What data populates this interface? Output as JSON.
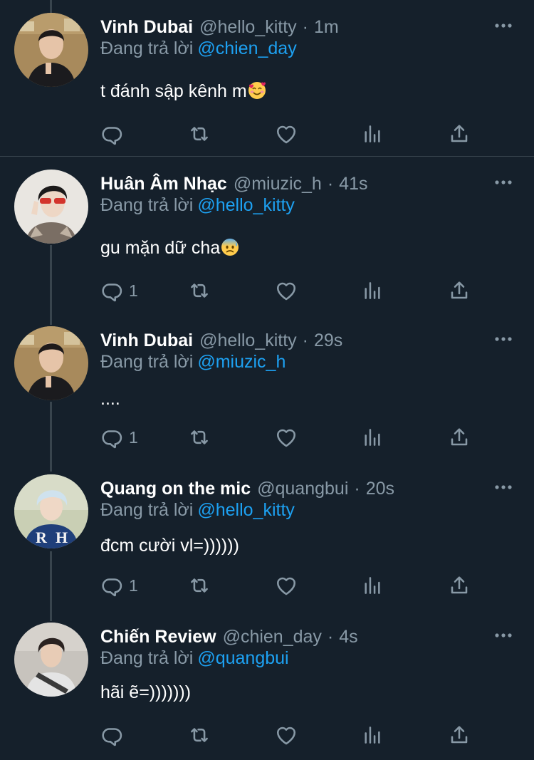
{
  "tweets": [
    {
      "name": "Vinh Dubai",
      "handle": "@hello_kitty",
      "time": "1m",
      "reply_label": "Đang trả lời",
      "reply_to": "@chien_day",
      "text": "t đánh sập kênh m",
      "emoji": "smiling-face-with-hearts",
      "reply_count": ""
    },
    {
      "name": "Huân Âm Nhạc",
      "handle": "@miuzic_h",
      "time": "41s",
      "reply_label": "Đang trả lời",
      "reply_to": "@hello_kitty",
      "text": "gu mặn dữ cha",
      "emoji": "anxious-face-with-sweat",
      "reply_count": "1"
    },
    {
      "name": "Vinh Dubai",
      "handle": "@hello_kitty",
      "time": "29s",
      "reply_label": "Đang trả lời",
      "reply_to": "@miuzic_h",
      "text": "....",
      "emoji": "",
      "reply_count": "1"
    },
    {
      "name": "Quang on the mic",
      "handle": "@quangbui",
      "time": "20s",
      "reply_label": "Đang trả lời",
      "reply_to": "@hello_kitty",
      "text": "đcm cười vl=))))))",
      "emoji": "",
      "reply_count": "1"
    },
    {
      "name": "Chiến Review",
      "handle": "@chien_day",
      "time": "4s",
      "reply_label": "Đang trả lời",
      "reply_to": "@quangbui",
      "text": "hãi ẽ=)))))))",
      "emoji": "",
      "reply_count": ""
    }
  ],
  "dot_separator": "·",
  "icons": [
    "reply-icon",
    "retweet-icon",
    "like-icon",
    "analytics-icon",
    "share-icon",
    "more-options-icon"
  ],
  "colors": {
    "background": "#15202b",
    "secondary_text": "#8899a6",
    "link": "#1da1f2",
    "divider": "#38444d"
  }
}
